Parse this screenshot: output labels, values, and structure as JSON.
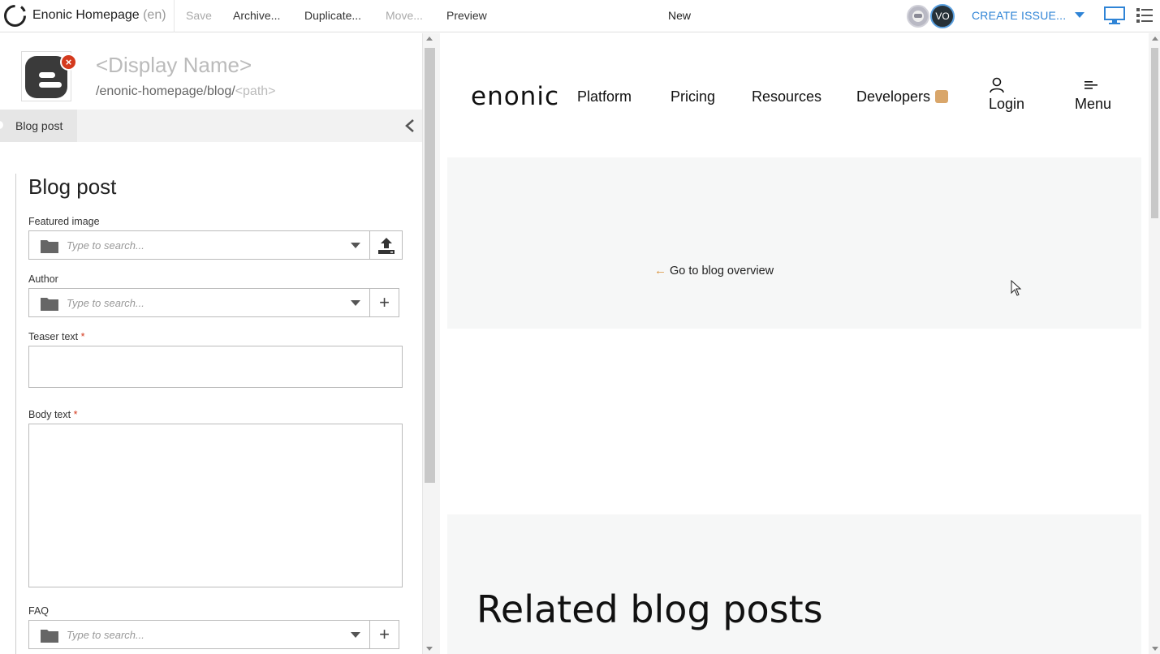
{
  "toolbar": {
    "project_name": "Enonic Homepage",
    "project_lang": "(en)",
    "save_label": "Save",
    "archive_label": "Archive...",
    "duplicate_label": "Duplicate...",
    "move_label": "Move...",
    "preview_label": "Preview",
    "status": "New",
    "user_initials": "VO",
    "create_issue_label": "CREATE ISSUE..."
  },
  "editor": {
    "display_name_placeholder": "<Display Name>",
    "path_prefix": "/enonic-homepage/blog/",
    "path_placeholder": "<path>",
    "tab_label": "Blog post",
    "form_title": "Blog post",
    "fields": {
      "featured_image": {
        "label": "Featured image",
        "placeholder": "Type to search..."
      },
      "author": {
        "label": "Author",
        "placeholder": "Type to search..."
      },
      "teaser_text": {
        "label": "Teaser text",
        "required_mark": "*"
      },
      "body_text": {
        "label": "Body text",
        "required_mark": "*"
      },
      "faq": {
        "label": "FAQ",
        "placeholder": "Type to search..."
      }
    }
  },
  "preview": {
    "logo_text": "enonic",
    "nav": {
      "platform": "Platform",
      "pricing": "Pricing",
      "resources": "Resources",
      "developers": "Developers",
      "login": "Login",
      "menu": "Menu"
    },
    "back_link": "Go to blog overview",
    "related_title": "Related blog posts"
  },
  "colors": {
    "accent_blue": "#2f84d6",
    "required_red": "#d43a1e",
    "back_arrow": "#d9933d"
  },
  "icons": [
    "app-logo-icon",
    "user-avatar-icon",
    "create-issue-caret-icon",
    "monitor-icon",
    "list-icon",
    "content-type-icon",
    "remove-badge-icon",
    "collapse-left-icon",
    "folder-icon",
    "dropdown-caret-icon",
    "upload-icon",
    "plus-icon",
    "user-icon",
    "menu-icon",
    "back-arrow-icon",
    "mouse-cursor-icon"
  ]
}
